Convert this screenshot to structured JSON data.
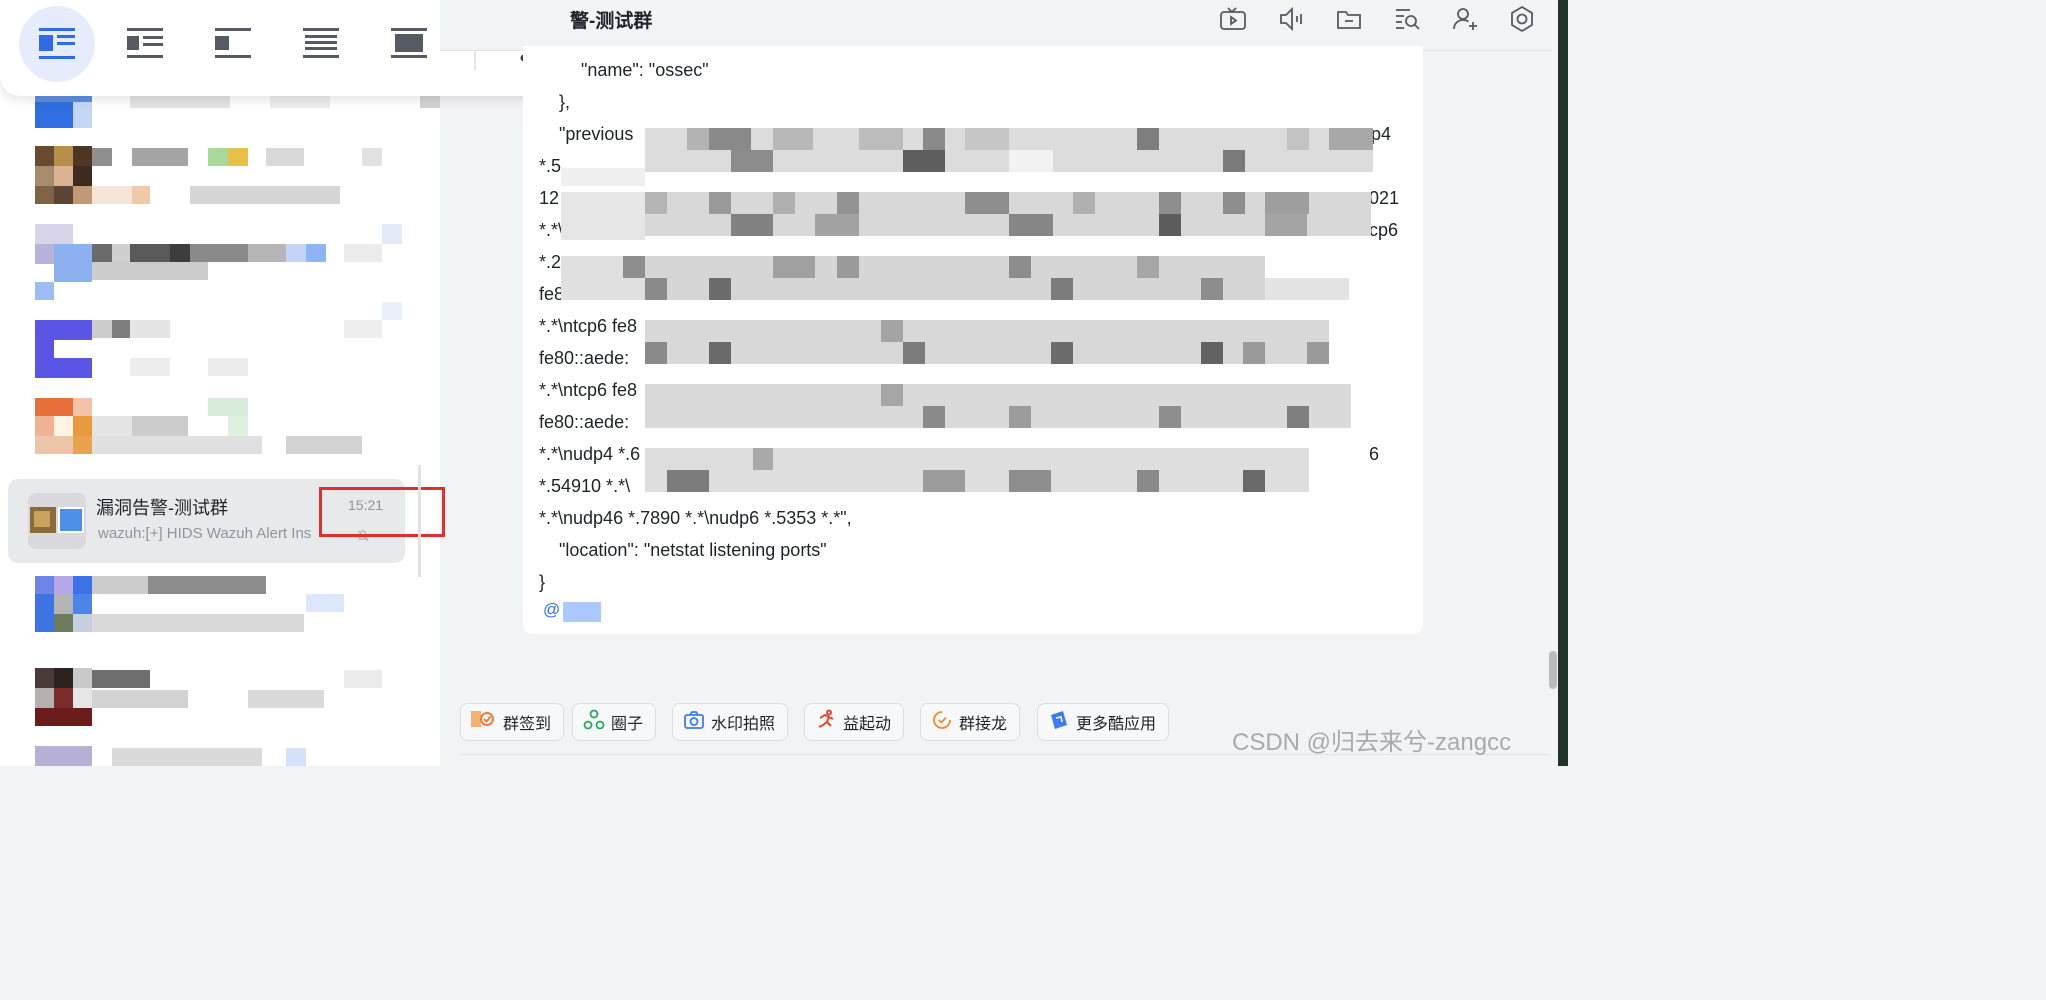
{
  "view_toolbar": {
    "buttons": [
      "layout-list-view-icon",
      "layout-card-view-icon",
      "layout-compact-view-icon",
      "layout-text-view-icon",
      "layout-dense-view-icon"
    ],
    "more": "more-vertical-icon",
    "active_index": 0
  },
  "chat_list": {
    "selected": {
      "title": "漏洞告警-测试群",
      "time": "15:21",
      "preview": "wazuh:[+] HIDS Wazuh Alert Ins"
    }
  },
  "chat_header": {
    "title": "警-测试群",
    "icons": [
      "video-icon",
      "speaker-icon",
      "folder-icon",
      "search-history-icon",
      "add-member-icon",
      "settings-icon"
    ]
  },
  "message": {
    "lines": [
      "\"name\": \"ossec\"",
      "},",
      "\"previous",
      "p4",
      "*.5",
      "12",
      "021",
      "*.*\\",
      "cp6",
      "*.2",
      "fe8",
      "*.*\\ntcp6 fe8",
      "fe80::aede:",
      "*.*\\ntcp6 fe8",
      "fe80::aede:",
      "*.*\\nudp4 *.6",
      "6",
      "*.54910 *.*\\",
      "*.*\\nudp46 *.7890 *.*\\nudp6 *.5353 *.*\",",
      "\"location\": \"netstat listening ports\"",
      "}"
    ],
    "mention": "@"
  },
  "app_bar": {
    "buttons": [
      {
        "label": "群签到",
        "icon": "sign-in-icon"
      },
      {
        "label": "圈子",
        "icon": "circle-icon"
      },
      {
        "label": "水印拍照",
        "icon": "camera-icon"
      },
      {
        "label": "益起动",
        "icon": "run-icon"
      },
      {
        "label": "群接龙",
        "icon": "relay-icon"
      },
      {
        "label": "更多酷应用",
        "icon": "more-apps-icon"
      }
    ]
  },
  "watermark": "CSDN @归去来兮-zangcc",
  "colors": {
    "accent": "#3370ff",
    "highlight_red": "#e0302e",
    "panel_bg": "#ffffff",
    "window_bg": "#f2f3f5"
  }
}
